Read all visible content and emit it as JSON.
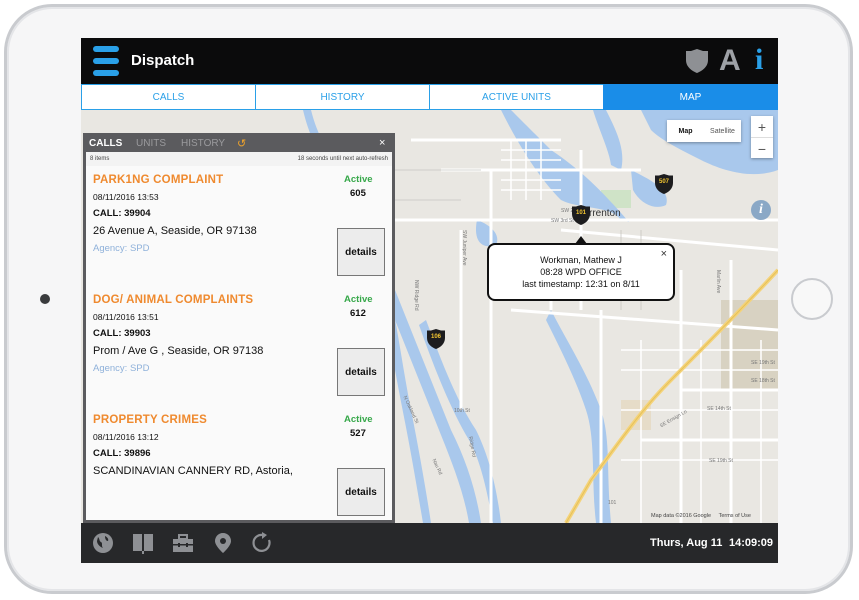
{
  "app": {
    "title": "Dispatch",
    "font_size_label": "A",
    "info_label": "i"
  },
  "tabs": [
    {
      "label": "CALLS",
      "active": false
    },
    {
      "label": "HISTORY",
      "active": false
    },
    {
      "label": "ACTIVE UNITS",
      "active": false
    },
    {
      "label": "MAP",
      "active": true
    }
  ],
  "map": {
    "type_options": [
      "Map",
      "Satellite"
    ],
    "selected_type": "Map",
    "zoom_in": "+",
    "zoom_out": "−",
    "info": "i",
    "town_label": "rrenton",
    "street_labels": [
      "SE Marlin Ave",
      "SW 2nd St",
      "SW 3rd St",
      "SW Juniper Ave",
      "NW Ridge Rd",
      "N Ridge Rd",
      "SW 9th St",
      "10th St",
      "N Oakland St",
      "Nau Rd",
      "Ridge Rd",
      "Valley Rd",
      "SE Ensign Ln",
      "SE 16th St",
      "SE 19th St",
      "SE 14th St",
      "SW Main Ave",
      "Marlin Ave",
      "SE 12th Pl",
      "SE 19th St",
      "SE 18th St",
      "101"
    ],
    "units": [
      {
        "id": "101"
      },
      {
        "id": "106"
      },
      {
        "id": "507"
      }
    ],
    "popup": {
      "name": "Workman, Mathew J",
      "location": "08:28 WPD OFFICE",
      "timestamp": "last timestamp: 12:31 on 8/11",
      "close": "×"
    },
    "attribution_data": "Map data ©2016 Google",
    "attribution_terms": "Terms of Use"
  },
  "panel": {
    "tabs": [
      {
        "label": "CALLS",
        "active": true
      },
      {
        "label": "UNITS",
        "active": false
      },
      {
        "label": "HISTORY",
        "active": false
      }
    ],
    "refresh_icon": "↺",
    "close": "×",
    "item_count": "8 items",
    "refresh_note": "18 seconds until next auto-refresh",
    "calls": [
      {
        "type": "PARK1NG COMPLAINT",
        "datetime": "08/11/2016 13:53",
        "call_number": "CALL: 39904",
        "address": "26 Avenue A, Seaside, OR 97138",
        "agency": "Agency: SPD",
        "status": "Active",
        "unit": "605",
        "details_label": "details"
      },
      {
        "type": "DOG/ ANIMAL COMPLAINTS",
        "datetime": "08/11/2016 13:51",
        "call_number": "CALL: 39903",
        "address": "Prom / Ave G , Seaside, OR 97138",
        "agency": "Agency: SPD",
        "status": "Active",
        "unit": "612",
        "details_label": "details"
      },
      {
        "type": "PROPERTY CRIMES",
        "datetime": "08/11/2016 13:12",
        "call_number": "CALL: 39896",
        "address": "SCANDINAVIAN CANNERY RD, Astoria,",
        "agency": "",
        "status": "Active",
        "unit": "527",
        "details_label": "details"
      }
    ]
  },
  "bottom_bar": {
    "icons": [
      "globe-icon",
      "book-icon",
      "toolbox-icon",
      "location-pin-icon",
      "refresh-icon"
    ],
    "date": "Thurs, Aug 11",
    "time": "14:09:09"
  },
  "colors": {
    "accent_blue": "#2aa0e8",
    "active_tab": "#1a8de8",
    "call_type_orange": "#ef8a2f",
    "status_green": "#37a84a",
    "agency_blue": "#8fb1da",
    "water": "#a9c8ec",
    "unit_marker_text": "#f2c531"
  }
}
